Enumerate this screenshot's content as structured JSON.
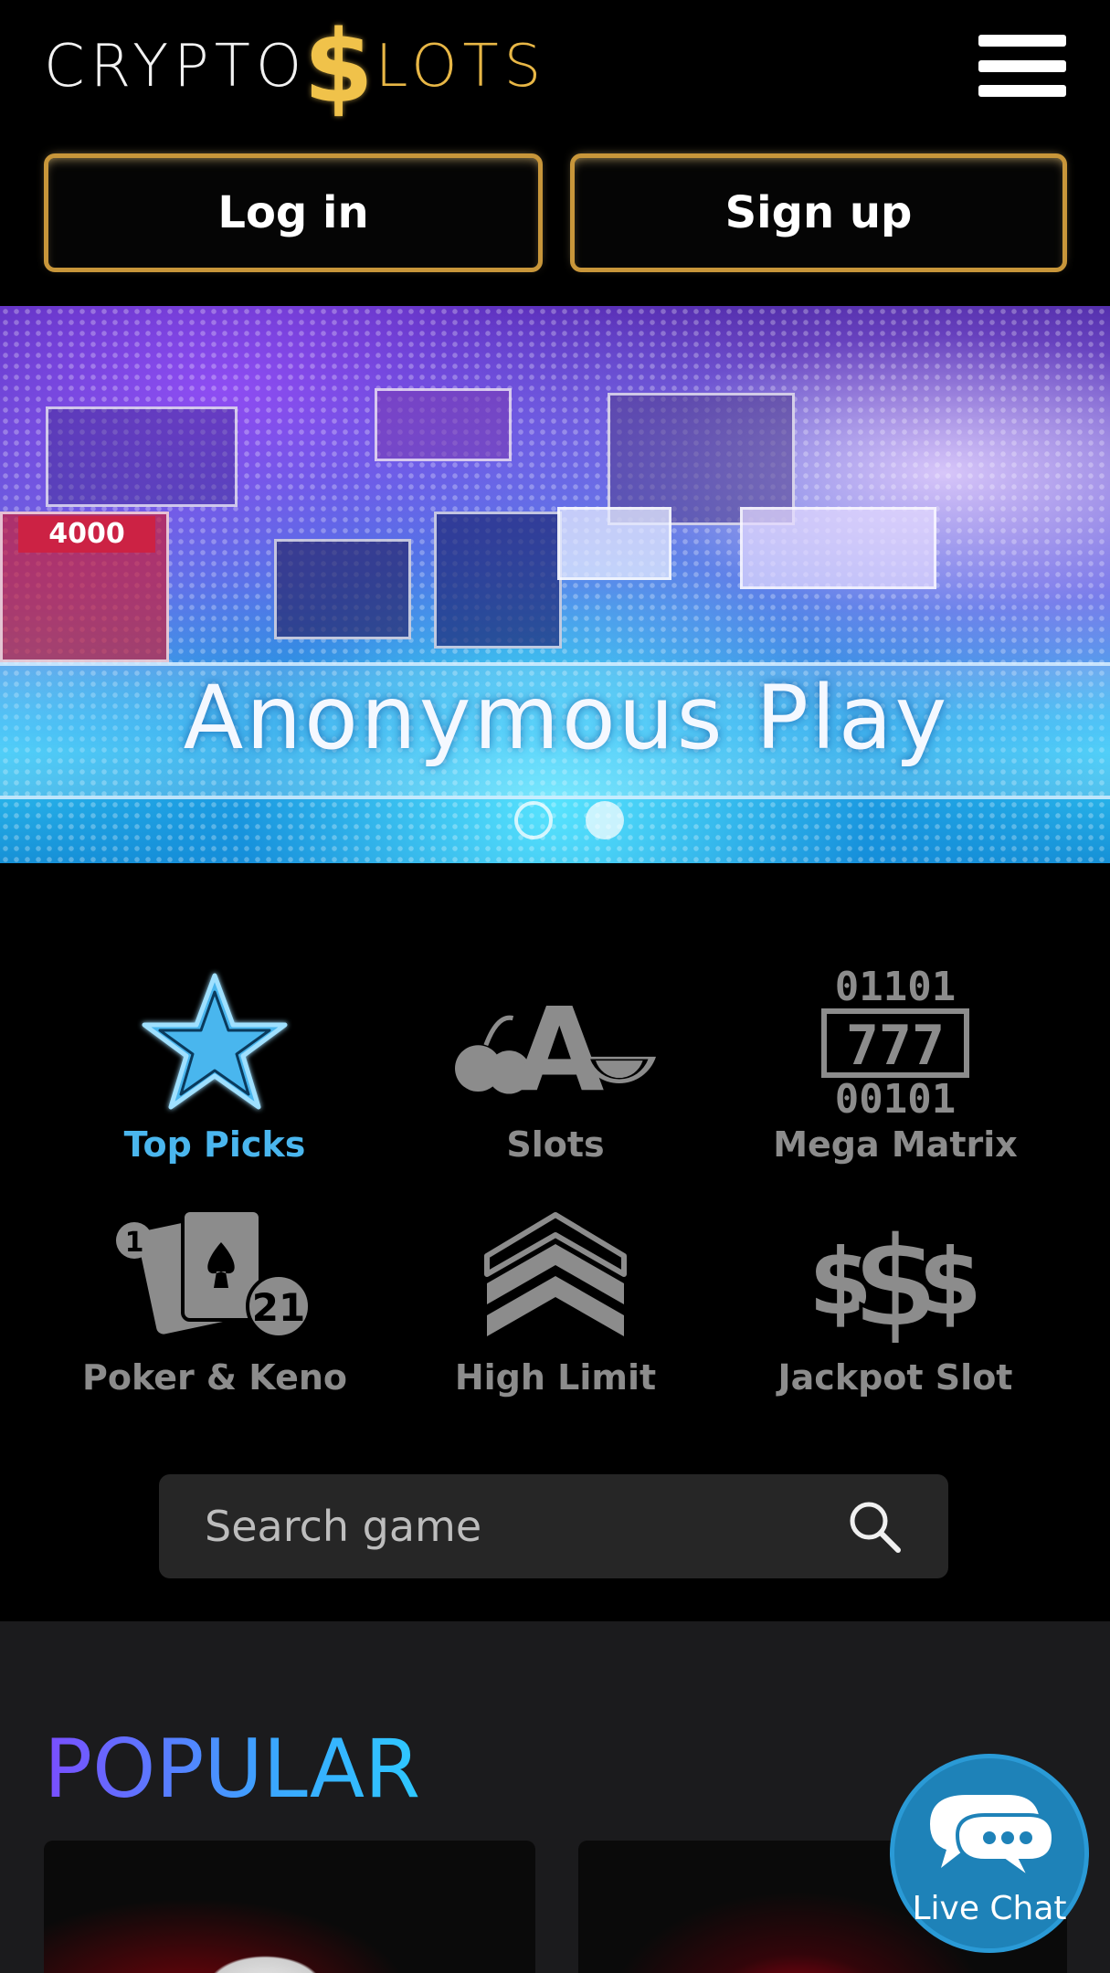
{
  "header": {
    "logo": {
      "part_a": "CRYPTO",
      "part_s": "$",
      "part_b": "LOTS"
    },
    "menu_icon": "hamburger-menu-icon",
    "login_label": "Log in",
    "signup_label": "Sign up",
    "accent_color": "#c8963a"
  },
  "hero": {
    "title": "Anonymous Play",
    "amount": "4000",
    "slide_count": 2,
    "active_slide": 2
  },
  "categories": [
    {
      "label": "Top Picks",
      "icon": "star-icon",
      "active": true
    },
    {
      "label": "Slots",
      "icon": "slots-fruit-icon",
      "active": false
    },
    {
      "label": "Mega Matrix",
      "icon": "mega-matrix-icon",
      "active": false,
      "icon_text_top": "01101",
      "icon_text_mid": "777",
      "icon_text_bottom": "00101"
    },
    {
      "label": "Poker & Keno",
      "icon": "cards-icon",
      "active": false,
      "icon_text_a": "1",
      "icon_text_b": "21"
    },
    {
      "label": "High Limit",
      "icon": "chevrons-icon",
      "active": false
    },
    {
      "label": "Jackpot Slot",
      "icon": "dollar-signs-icon",
      "active": false,
      "icon_text": "$$$"
    }
  ],
  "search": {
    "placeholder": "Search game",
    "icon": "search-icon"
  },
  "popular": {
    "title": "POPULAR"
  },
  "live_chat": {
    "label": "Live Chat",
    "icon": "chat-bubbles-icon",
    "color": "#1e82b8"
  },
  "colors": {
    "active_category": "#4ab6ee",
    "inactive_category": "#8c8c8c",
    "popular_gradient_start": "#7a4dff",
    "popular_gradient_end": "#2ec8ff"
  }
}
